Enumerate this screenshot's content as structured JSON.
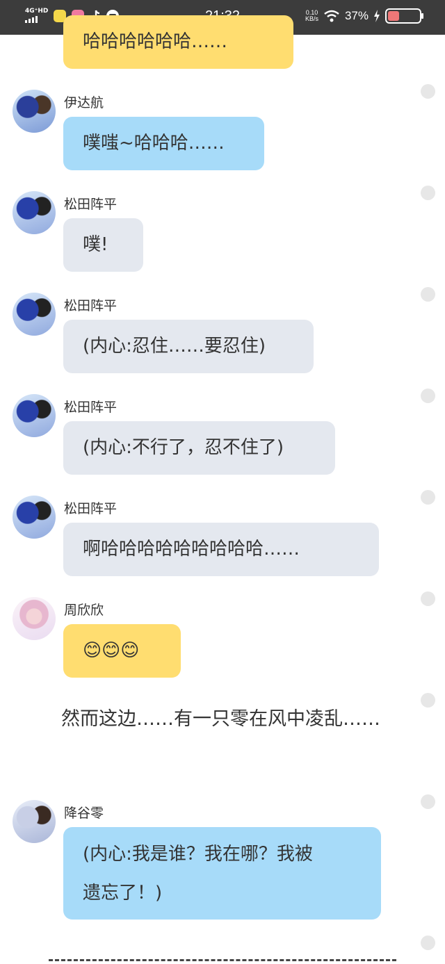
{
  "status_bar": {
    "network": "4G⁺HD",
    "time": "21:32",
    "net_speed_value": "0.10",
    "net_speed_unit": "KB/s",
    "battery": "37%",
    "battery_level": 0.37
  },
  "messages": [
    {
      "name": "",
      "text": "哈哈哈哈哈哈……",
      "color": "yellow"
    },
    {
      "name": "伊达航",
      "text": "噗嗤~哈哈哈……",
      "color": "blue"
    },
    {
      "name": "松田阵平",
      "text": "噗!",
      "color": "gray"
    },
    {
      "name": "松田阵平",
      "text": "(内心:忍住……要忍住)",
      "color": "gray"
    },
    {
      "name": "松田阵平",
      "text": "(内心:不行了，忍不住了)",
      "color": "gray"
    },
    {
      "name": "松田阵平",
      "text": "啊哈哈哈哈哈哈哈哈哈……",
      "color": "gray"
    },
    {
      "name": "周欣欣",
      "text": "😊😊😊",
      "color": "yellow"
    },
    {
      "name": "降谷零",
      "text_line1": "(内心:我是谁？我在哪？我被",
      "text_line2": "遗忘了！)",
      "color": "blue"
    }
  ],
  "narration": "然而这边……有一只零在风中凌乱……",
  "colors": {
    "yellow_bubble": "#ffdd70",
    "blue_bubble": "#a7dbf9",
    "gray_bubble": "#e4e8ef",
    "status_bar_bg": "#3c3c3c"
  }
}
